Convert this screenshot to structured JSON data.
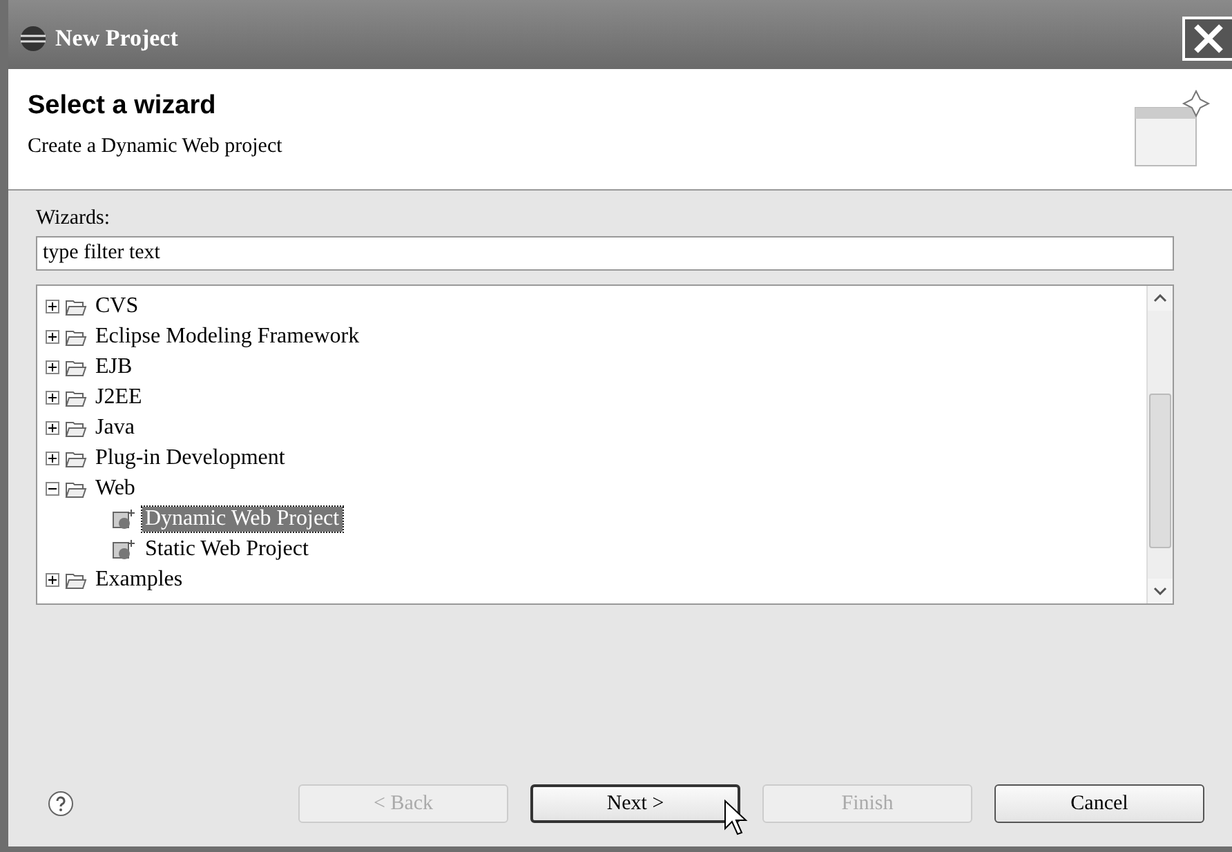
{
  "window": {
    "title": "New Project"
  },
  "header": {
    "title": "Select a wizard",
    "description": "Create a Dynamic Web project"
  },
  "wizards_label": "Wizards:",
  "filter": {
    "value": "type filter text"
  },
  "tree": [
    {
      "label": "CVS",
      "expanded": false,
      "selected": false,
      "kind": "folder"
    },
    {
      "label": "Eclipse Modeling Framework",
      "expanded": false,
      "selected": false,
      "kind": "folder"
    },
    {
      "label": "EJB",
      "expanded": false,
      "selected": false,
      "kind": "folder"
    },
    {
      "label": "J2EE",
      "expanded": false,
      "selected": false,
      "kind": "folder"
    },
    {
      "label": "Java",
      "expanded": false,
      "selected": false,
      "kind": "folder"
    },
    {
      "label": "Plug-in Development",
      "expanded": false,
      "selected": false,
      "kind": "folder"
    },
    {
      "label": "Web",
      "expanded": true,
      "selected": false,
      "kind": "folder",
      "children": [
        {
          "label": "Dynamic Web Project",
          "selected": true,
          "kind": "wizard"
        },
        {
          "label": "Static Web Project",
          "selected": false,
          "kind": "wizard"
        }
      ]
    },
    {
      "label": "Examples",
      "expanded": false,
      "selected": false,
      "kind": "folder"
    }
  ],
  "buttons": [
    {
      "label": "< Back",
      "disabled": true
    },
    {
      "label": "Next >",
      "disabled": false
    },
    {
      "label": "Finish",
      "disabled": true
    },
    {
      "label": "Cancel",
      "disabled": false
    }
  ]
}
